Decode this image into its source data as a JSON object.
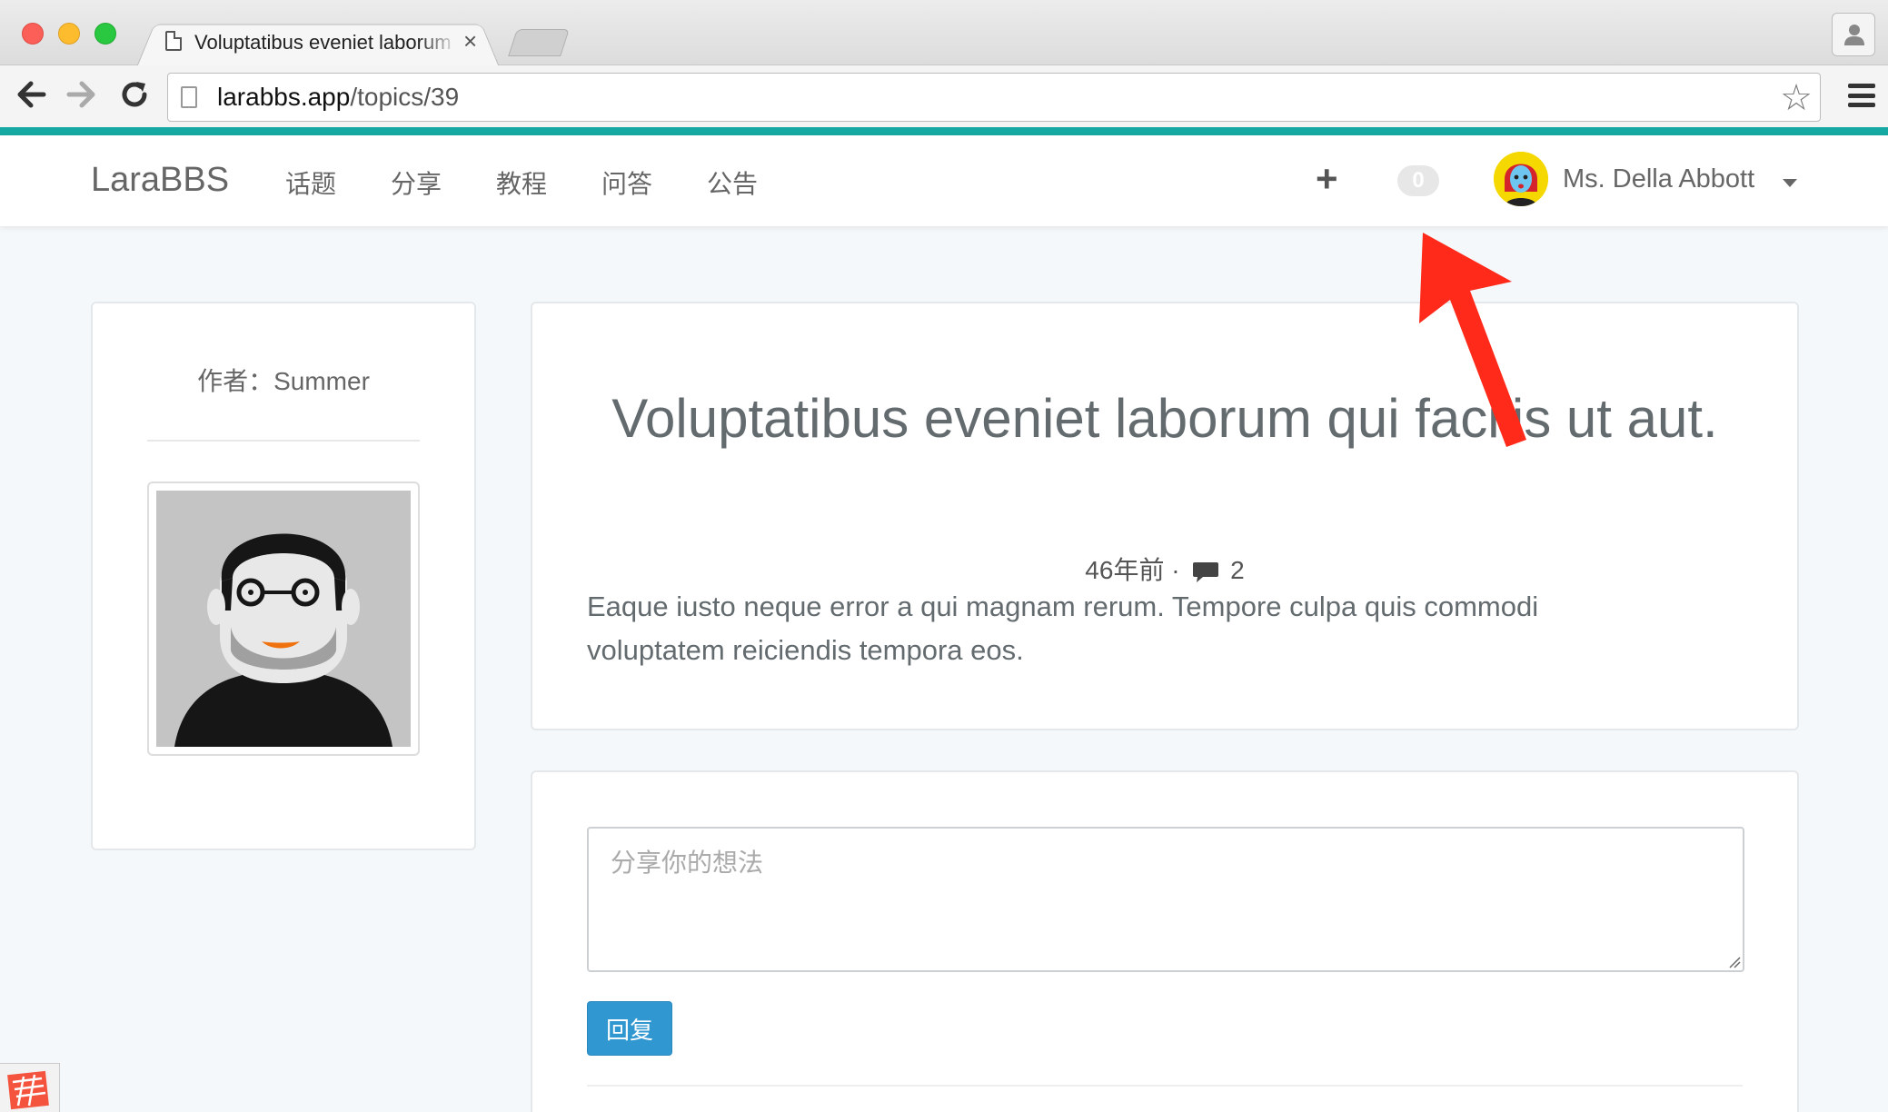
{
  "browser": {
    "tab_title": "Voluptatibus eveniet laborum qui facilis ut aut.",
    "tab_close": "×",
    "url_host": "larabbs.app",
    "url_path": "/topics/39",
    "bookmark_star": "☆"
  },
  "navbar": {
    "brand": "LaraBBS",
    "links": [
      "话题",
      "分享",
      "教程",
      "问答",
      "公告"
    ],
    "create_label": "+",
    "notification_count": "0",
    "user_name": "Ms. Della Abbott"
  },
  "author": {
    "label": "作者：Summer"
  },
  "topic": {
    "title": "Voluptatibus eveniet laborum qui facilis ut aut.",
    "time_ago": "46年前",
    "separator": "·",
    "reply_count": "2",
    "body": "Eaque iusto neque error a qui magnam rerum. Tempore culpa quis commodi voluptatem reiciendis tempora eos."
  },
  "reply": {
    "placeholder": "分享你的想法",
    "submit_label": "回复"
  },
  "colors": {
    "accent_line": "#16a8a2",
    "reply_button": "#3097d1",
    "annotation_arrow": "#ff2a1a"
  }
}
